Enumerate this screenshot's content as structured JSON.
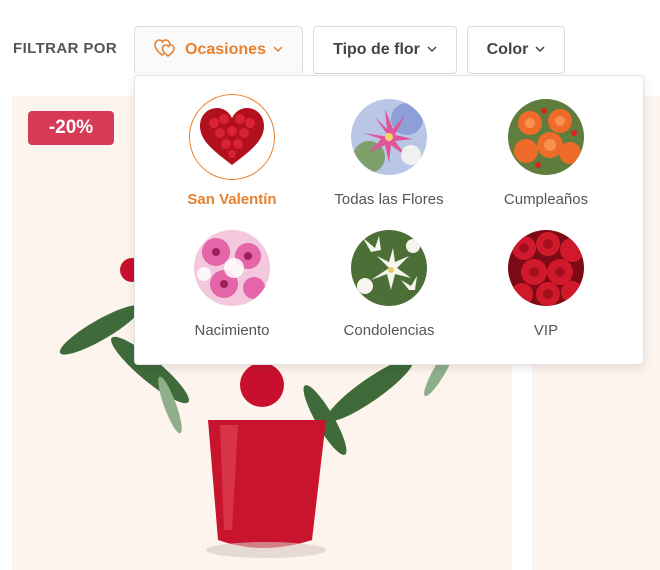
{
  "filter": {
    "label": "FILTRAR POR",
    "buttons": [
      {
        "label": "Ocasiones",
        "icon": "hearts-icon",
        "active": true
      },
      {
        "label": "Tipo de flor",
        "icon": "chevron-down-icon"
      },
      {
        "label": "Color",
        "icon": "chevron-down-icon"
      }
    ]
  },
  "occasions": [
    {
      "label": "San Valentín",
      "selected": true
    },
    {
      "label": "Todas las Flores"
    },
    {
      "label": "Cumpleaños"
    },
    {
      "label": "Nacimiento"
    },
    {
      "label": "Condolencias"
    },
    {
      "label": "VIP"
    }
  ],
  "product": {
    "discount": "-20%"
  },
  "colors": {
    "accent": "#e8812f",
    "badge": "#d63a56",
    "card_bg": "#fdf4ee"
  }
}
